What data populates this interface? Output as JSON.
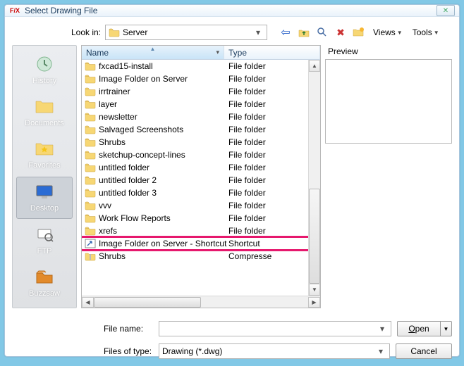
{
  "window": {
    "title": "Select Drawing File"
  },
  "lookin": {
    "label": "Look in:",
    "value": "Server"
  },
  "toolbar": {
    "views_label": "Views",
    "tools_label": "Tools"
  },
  "sidebar": {
    "items": [
      {
        "label": "History"
      },
      {
        "label": "Documents"
      },
      {
        "label": "Favorites"
      },
      {
        "label": "Desktop"
      },
      {
        "label": "FTP"
      },
      {
        "label": "Buzzsaw"
      }
    ]
  },
  "columns": {
    "name": "Name",
    "type": "Type"
  },
  "files": [
    {
      "name": "fxcad15-install",
      "type": "File folder",
      "kind": "folder"
    },
    {
      "name": "Image Folder on Server",
      "type": "File folder",
      "kind": "folder"
    },
    {
      "name": "irrtrainer",
      "type": "File folder",
      "kind": "folder"
    },
    {
      "name": "layer",
      "type": "File folder",
      "kind": "folder"
    },
    {
      "name": "newsletter",
      "type": "File folder",
      "kind": "folder"
    },
    {
      "name": "Salvaged Screenshots",
      "type": "File folder",
      "kind": "folder"
    },
    {
      "name": "Shrubs",
      "type": "File folder",
      "kind": "folder"
    },
    {
      "name": "sketchup-concept-lines",
      "type": "File folder",
      "kind": "folder"
    },
    {
      "name": "untitled folder",
      "type": "File folder",
      "kind": "folder"
    },
    {
      "name": "untitled folder 2",
      "type": "File folder",
      "kind": "folder"
    },
    {
      "name": "untitled folder 3",
      "type": "File folder",
      "kind": "folder"
    },
    {
      "name": "vvv",
      "type": "File folder",
      "kind": "folder"
    },
    {
      "name": "Work Flow Reports",
      "type": "File folder",
      "kind": "folder"
    },
    {
      "name": "xrefs",
      "type": "File folder",
      "kind": "folder"
    },
    {
      "name": "Image Folder on Server - Shortcut",
      "type": "Shortcut",
      "kind": "shortcut",
      "highlight": true
    },
    {
      "name": "Shrubs",
      "type": "Compresse",
      "kind": "zip"
    }
  ],
  "preview": {
    "label": "Preview"
  },
  "filename": {
    "label": "File name:",
    "value": ""
  },
  "filetype": {
    "label": "Files of type:",
    "value": "Drawing (*.dwg)"
  },
  "buttons": {
    "open": "Open",
    "cancel": "Cancel"
  }
}
